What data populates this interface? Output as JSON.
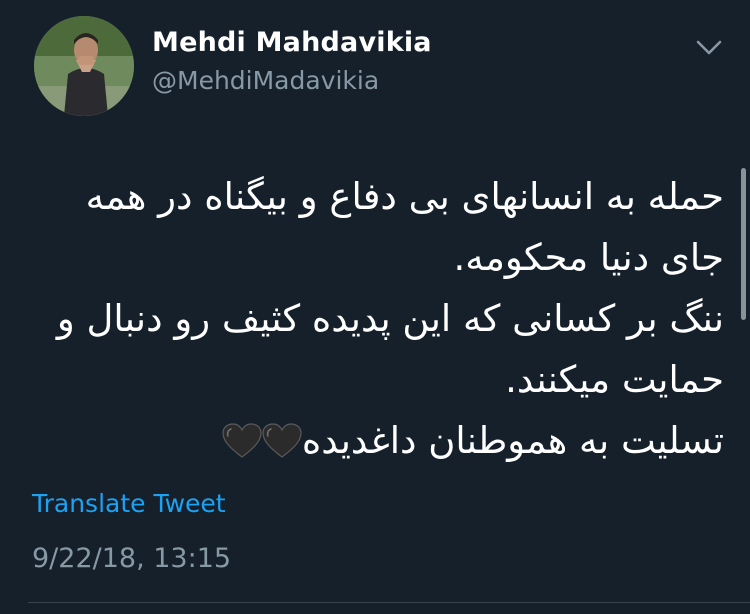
{
  "user": {
    "display_name": "Mehdi Mahdavikia",
    "handle": "@MehdiMadavikia"
  },
  "tweet": {
    "lines": [
      "حمله به انسانهای بی دفاع و بیگناه در همه",
      "جای دنیا محکومه.",
      "ننگ بر کسانی که این پدیده کثیف رو دنبال و",
      "حمایت میکنند.",
      "تسلیت به هموطنان داغدیده"
    ],
    "emoji": [
      "black-heart",
      "black-heart"
    ],
    "translate_label": "Translate Tweet",
    "timestamp": "9/22/18, 13:15"
  },
  "colors": {
    "background": "#15202b",
    "text": "#ffffff",
    "secondary": "#8899a6",
    "link": "#1da1f2"
  }
}
